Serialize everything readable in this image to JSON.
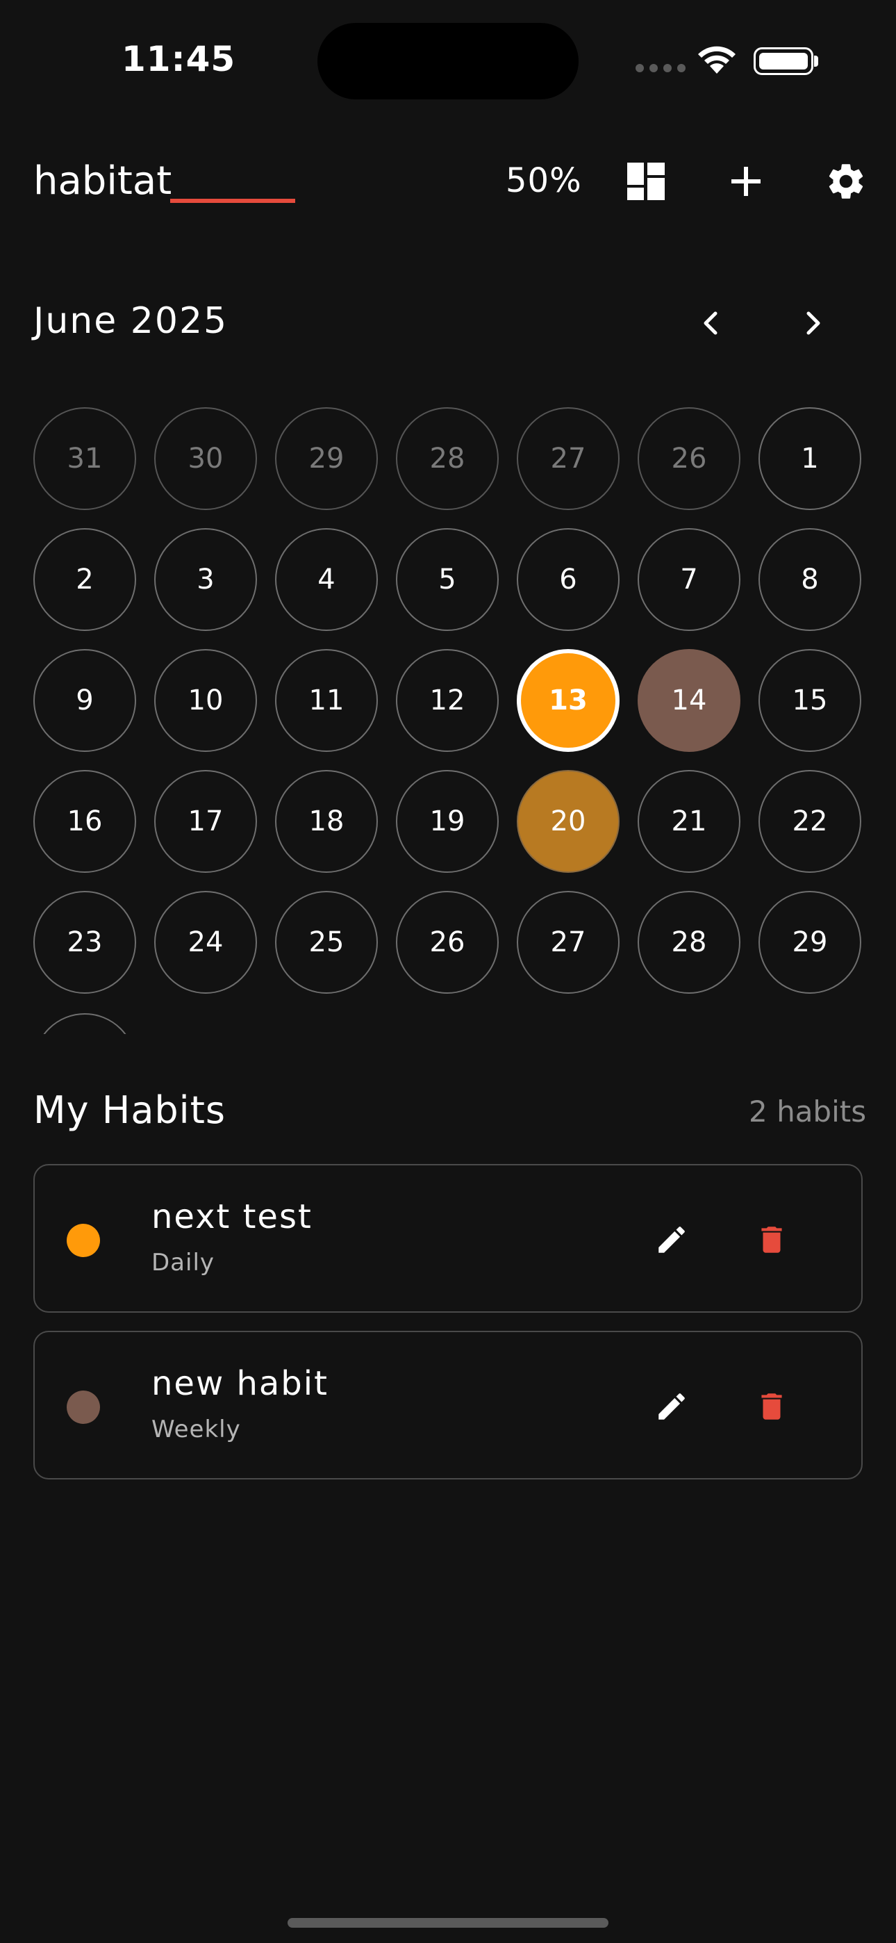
{
  "status_bar": {
    "time": "11:45"
  },
  "header": {
    "app_title": "habitat",
    "completion_percent": "50%",
    "icons": [
      "dashboard-icon",
      "add-icon",
      "gear-icon"
    ]
  },
  "calendar": {
    "month_label": "June 2025",
    "days": [
      {
        "label": "31",
        "state": "muted"
      },
      {
        "label": "30",
        "state": "muted"
      },
      {
        "label": "29",
        "state": "muted"
      },
      {
        "label": "28",
        "state": "muted"
      },
      {
        "label": "27",
        "state": "muted"
      },
      {
        "label": "26",
        "state": "muted"
      },
      {
        "label": "1",
        "state": "normal"
      },
      {
        "label": "2",
        "state": "normal"
      },
      {
        "label": "3",
        "state": "normal"
      },
      {
        "label": "4",
        "state": "normal"
      },
      {
        "label": "5",
        "state": "normal"
      },
      {
        "label": "6",
        "state": "normal"
      },
      {
        "label": "7",
        "state": "normal"
      },
      {
        "label": "8",
        "state": "normal"
      },
      {
        "label": "9",
        "state": "normal"
      },
      {
        "label": "10",
        "state": "normal"
      },
      {
        "label": "11",
        "state": "normal"
      },
      {
        "label": "12",
        "state": "normal"
      },
      {
        "label": "13",
        "state": "today"
      },
      {
        "label": "14",
        "state": "brown"
      },
      {
        "label": "15",
        "state": "normal"
      },
      {
        "label": "16",
        "state": "normal"
      },
      {
        "label": "17",
        "state": "normal"
      },
      {
        "label": "18",
        "state": "normal"
      },
      {
        "label": "19",
        "state": "normal"
      },
      {
        "label": "20",
        "state": "amber"
      },
      {
        "label": "21",
        "state": "normal"
      },
      {
        "label": "22",
        "state": "normal"
      },
      {
        "label": "23",
        "state": "normal"
      },
      {
        "label": "24",
        "state": "normal"
      },
      {
        "label": "25",
        "state": "normal"
      },
      {
        "label": "26",
        "state": "normal"
      },
      {
        "label": "27",
        "state": "normal"
      },
      {
        "label": "28",
        "state": "normal"
      },
      {
        "label": "29",
        "state": "normal"
      }
    ]
  },
  "habits": {
    "section_title": "My Habits",
    "count_label": "2 habits",
    "items": [
      {
        "name": "next test",
        "frequency": "Daily",
        "color": "#ff9a0a"
      },
      {
        "name": "new habit",
        "frequency": "Weekly",
        "color": "#7a5a4e"
      }
    ]
  },
  "colors": {
    "background": "#121212",
    "accent_orange": "#ff9a0a",
    "delete_red": "#e64b3c",
    "title_underline": "#e64b3c"
  }
}
